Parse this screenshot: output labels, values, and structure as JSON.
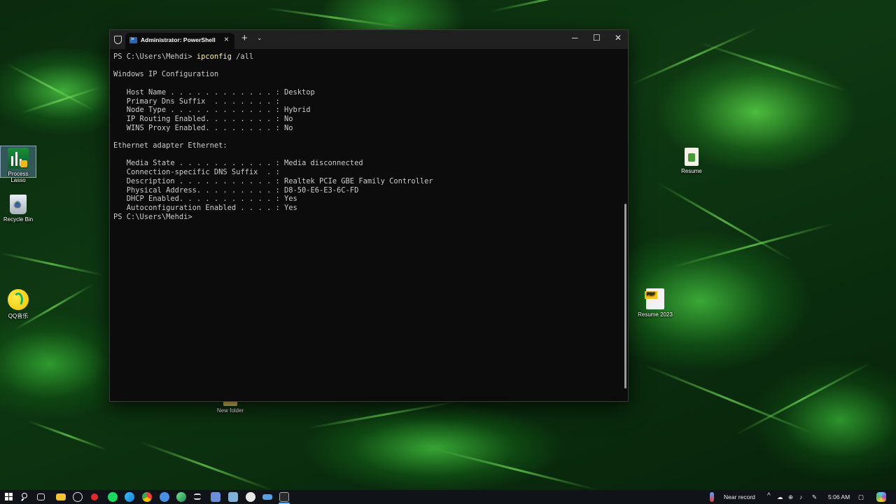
{
  "desktop": {
    "icons": [
      {
        "label": "Process Lasso"
      },
      {
        "label": "Recycle Bin"
      },
      {
        "label": "QQ音乐"
      },
      {
        "label": "Resume"
      },
      {
        "label": "Resume 2023"
      },
      {
        "label": "New folder"
      }
    ]
  },
  "window": {
    "tab_title": "Administrator: PowerShell",
    "new_tab_glyph": "+",
    "controls": {
      "minimize": "─",
      "maximize": "☐",
      "close": "✕"
    }
  },
  "console": {
    "prompt": "PS C:\\Users\\Mehdi> ",
    "command": "ipconfig",
    "command_args": " /all",
    "lines": [
      "",
      "Windows IP Configuration",
      "",
      "   Host Name . . . . . . . . . . . . : Desktop",
      "   Primary Dns Suffix  . . . . . . . :",
      "   Node Type . . . . . . . . . . . . : Hybrid",
      "   IP Routing Enabled. . . . . . . . : No",
      "   WINS Proxy Enabled. . . . . . . . : No",
      "",
      "Ethernet adapter Ethernet:",
      "",
      "   Media State . . . . . . . . . . . : Media disconnected",
      "   Connection-specific DNS Suffix  . :",
      "   Description . . . . . . . . . . . : Realtek PCIe GBE Family Controller",
      "   Physical Address. . . . . . . . . : D8-50-E6-E3-6C-FD",
      "   DHCP Enabled. . . . . . . . . . . : Yes",
      "   Autoconfiguration Enabled . . . . : Yes",
      "PS C:\\Users\\Mehdi>"
    ]
  },
  "taskbar": {
    "weather_text": "Near record",
    "clock": "5:06 AM",
    "tray_chevron": "^"
  }
}
